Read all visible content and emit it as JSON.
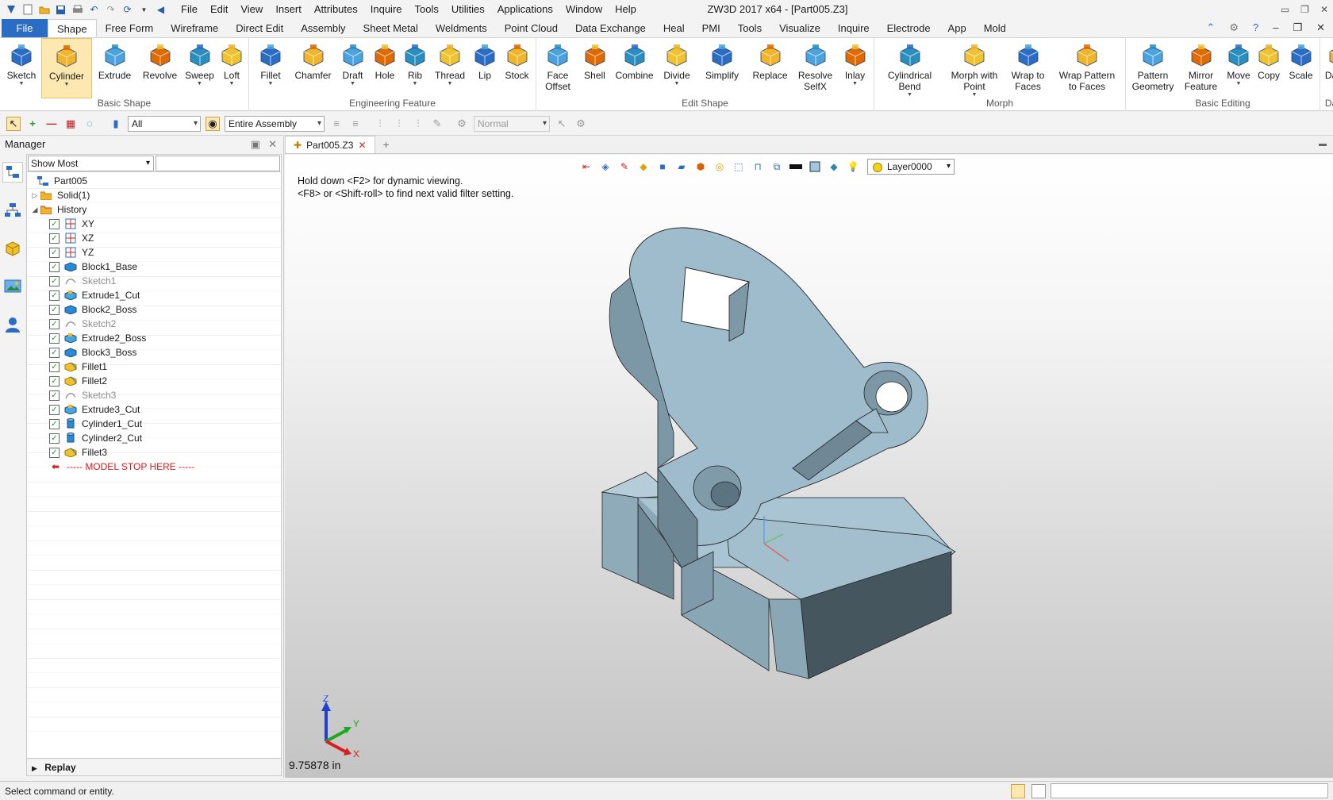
{
  "window": {
    "title": "ZW3D 2017  x64 - [Part005.Z3]",
    "menus": [
      "File",
      "Edit",
      "View",
      "Insert",
      "Attributes",
      "Inquire",
      "Tools",
      "Utilities",
      "Applications",
      "Window",
      "Help"
    ]
  },
  "ribbon_tabs": {
    "file": "File",
    "tabs": [
      "Shape",
      "Free Form",
      "Wireframe",
      "Direct Edit",
      "Assembly",
      "Sheet Metal",
      "Weldments",
      "Point Cloud",
      "Data Exchange",
      "Heal",
      "PMI",
      "Tools",
      "Visualize",
      "Inquire",
      "Electrode",
      "App",
      "Mold"
    ],
    "active": "Shape"
  },
  "ribbon": {
    "groups": [
      {
        "label": "Basic Shape",
        "tools": [
          "Sketch",
          "Cylinder",
          "Extrude",
          "Revolve",
          "Sweep",
          "Loft"
        ]
      },
      {
        "label": "Engineering Feature",
        "tools": [
          "Fillet",
          "Chamfer",
          "Draft",
          "Hole",
          "Rib",
          "Thread",
          "Lip",
          "Stock"
        ]
      },
      {
        "label": "Edit Shape",
        "tools": [
          "Face\nOffset",
          "Shell",
          "Combine",
          "Divide",
          "Simplify",
          "Replace",
          "Resolve\nSelfX",
          "Inlay"
        ]
      },
      {
        "label": "Morph",
        "tools": [
          "Cylindrical\nBend",
          "Morph with\nPoint",
          "Wrap to\nFaces",
          "Wrap Pattern\nto Faces"
        ]
      },
      {
        "label": "Basic Editing",
        "tools": [
          "Pattern\nGeometry",
          "Mirror\nFeature",
          "Move",
          "Copy",
          "Scale"
        ]
      },
      {
        "label": "Datum",
        "tools": [
          "Datum"
        ]
      }
    ]
  },
  "filterbar": {
    "filter": "All",
    "scope": "Entire Assembly",
    "mode": "Normal"
  },
  "manager": {
    "title": "Manager",
    "show": "Show Most",
    "search_value": "",
    "replay": "Replay",
    "tree": {
      "root": "Part005",
      "solid": "Solid(1)",
      "history": "History",
      "items": [
        {
          "label": "XY",
          "icon": "datum-plane-icon",
          "dim": false
        },
        {
          "label": "XZ",
          "icon": "datum-plane-icon",
          "dim": false
        },
        {
          "label": "YZ",
          "icon": "datum-plane-icon",
          "dim": false
        },
        {
          "label": "Block1_Base",
          "icon": "block-icon",
          "dim": false
        },
        {
          "label": "Sketch1",
          "icon": "sketch-icon",
          "dim": true
        },
        {
          "label": "Extrude1_Cut",
          "icon": "extrude-icon",
          "dim": false
        },
        {
          "label": "Block2_Boss",
          "icon": "block-icon",
          "dim": false
        },
        {
          "label": "Sketch2",
          "icon": "sketch-icon",
          "dim": true
        },
        {
          "label": "Extrude2_Boss",
          "icon": "extrude-icon",
          "dim": false
        },
        {
          "label": "Block3_Boss",
          "icon": "block-icon",
          "dim": false
        },
        {
          "label": "Fillet1",
          "icon": "fillet-icon",
          "dim": false
        },
        {
          "label": "Fillet2",
          "icon": "fillet-icon",
          "dim": false
        },
        {
          "label": "Sketch3",
          "icon": "sketch-icon",
          "dim": true
        },
        {
          "label": "Extrude3_Cut",
          "icon": "extrude-icon",
          "dim": false
        },
        {
          "label": "Cylinder1_Cut",
          "icon": "cylinder-icon",
          "dim": false
        },
        {
          "label": "Cylinder2_Cut",
          "icon": "cylinder-icon",
          "dim": false
        },
        {
          "label": "Fillet3",
          "icon": "fillet-icon",
          "dim": false
        }
      ],
      "stop": "----- MODEL STOP HERE -----"
    }
  },
  "document": {
    "tab": "Part005.Z3"
  },
  "viewport": {
    "hint1": "Hold down <F2> for dynamic viewing.",
    "hint2": "<F8> or <Shift-roll> to find next valid filter setting.",
    "layer": "Layer0000",
    "scale": "9.75878 in",
    "triad": {
      "x": "X",
      "y": "Y",
      "z": "Z"
    }
  },
  "status": {
    "text": "Select command or entity."
  },
  "colors": {
    "accent": "#2b6cc4",
    "part_face": "#9fbccc",
    "part_dark": "#45565f",
    "stop_red": "#d02020"
  }
}
